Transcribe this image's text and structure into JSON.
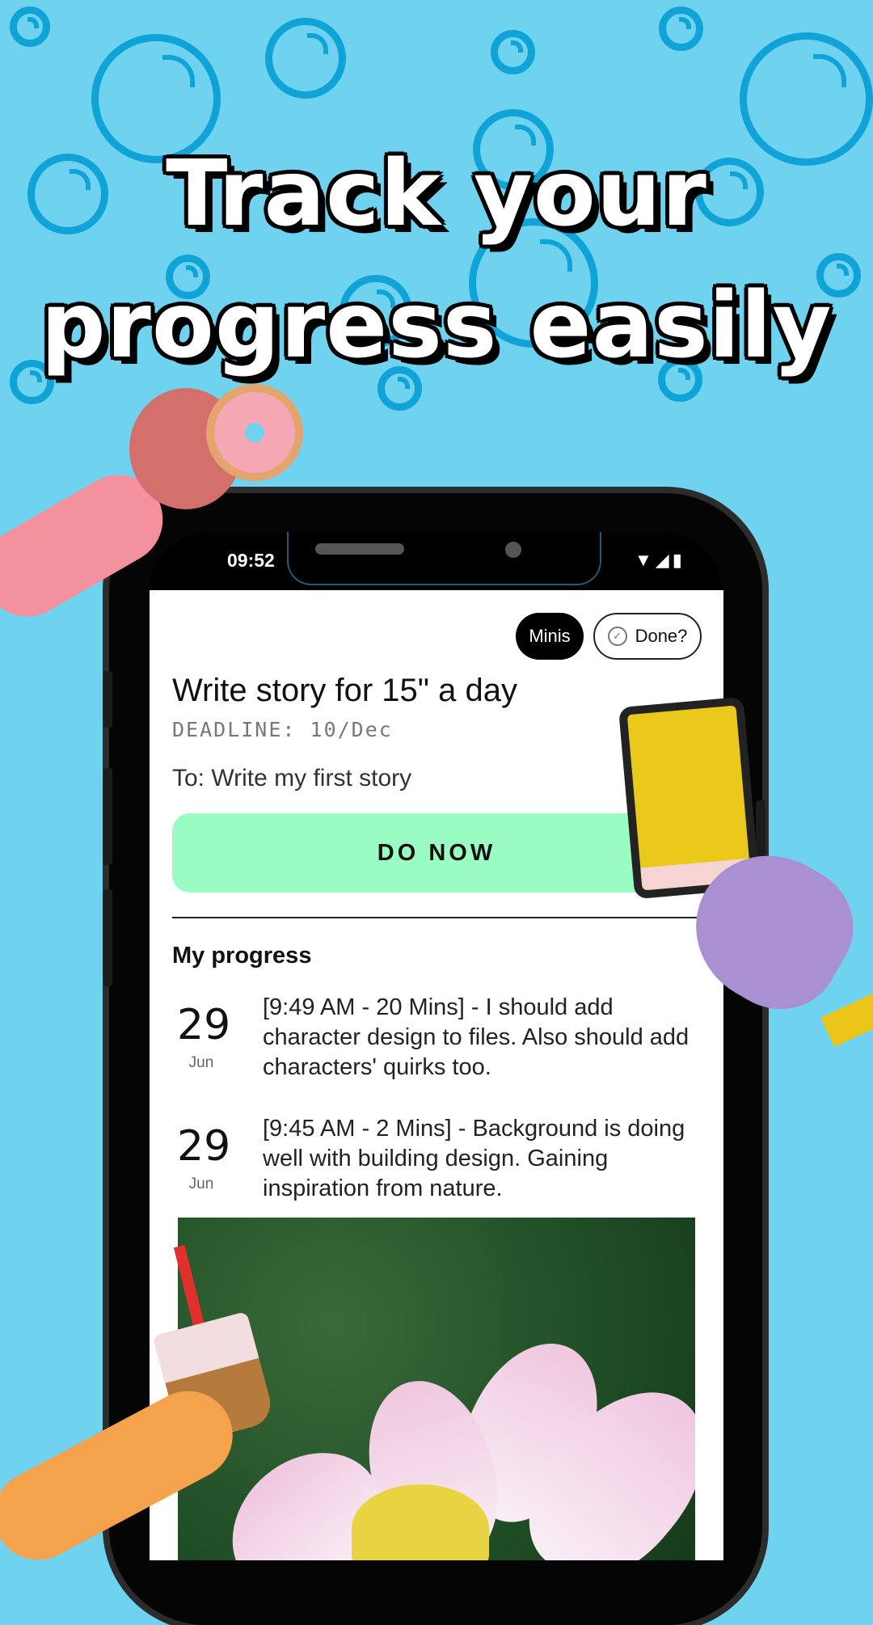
{
  "headline": {
    "line1": "Track your",
    "line2": "progress easily"
  },
  "status_bar": {
    "time": "09:52",
    "icons": "▼◢▮"
  },
  "task": {
    "chip_minis": "Minis",
    "chip_done": "Done?",
    "title": "Write story for 15\" a day",
    "deadline": "DEADLINE: 10/Dec",
    "goal": "To: Write my first story",
    "do_now_label": "DO NOW"
  },
  "progress": {
    "title": "My progress",
    "entries": [
      {
        "day": "29",
        "month": "Jun",
        "text": "[9:49 AM - 20 Mins]  - I should add character design to files. Also should add characters' quirks too."
      },
      {
        "day": "29",
        "month": "Jun",
        "text": "[9:45 AM - 2 Mins]  - Background is doing well with building design. Gaining inspiration from nature."
      }
    ]
  },
  "colors": {
    "background": "#6fd3f0",
    "bubble": "#10a3d8",
    "do_now": "#9bfcc3"
  }
}
